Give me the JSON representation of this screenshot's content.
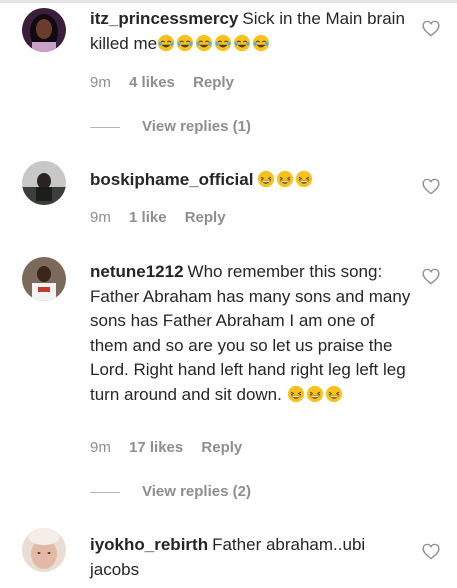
{
  "comments": [
    {
      "username": "itz_princessmercy",
      "text": "Sick in the Main brain killed me",
      "emoji": [
        "face-with-tears-of-joy-icon",
        "face-with-tears-of-joy-icon",
        "face-with-tears-of-joy-icon",
        "face-with-tears-of-joy-icon",
        "face-with-tears-of-joy-icon",
        "face-with-tears-of-joy-icon"
      ],
      "time": "9m",
      "likes": "4 likes",
      "reply": "Reply",
      "view_replies": "View replies (1)"
    },
    {
      "username": "boskiphame_official",
      "text": "",
      "emoji": [
        "laughing-face-icon",
        "laughing-face-icon",
        "laughing-face-icon"
      ],
      "time": "9m",
      "likes": "1 like",
      "reply": "Reply"
    },
    {
      "username": "netune1212",
      "text": "Who remember this song: Father Abraham has many sons and many sons has Father Abraham I am one of them and so are you so let us praise the Lord. Right hand left hand right leg left leg turn around and sit down.",
      "emoji": [
        "laughing-face-icon",
        "laughing-face-icon",
        "laughing-face-icon"
      ],
      "time": "9m",
      "likes": "17 likes",
      "reply": "Reply",
      "view_replies": "View replies (2)"
    },
    {
      "username": "iyokho_rebirth",
      "text": "Father abraham..ubi jacobs"
    }
  ],
  "icons": {
    "like": "heart-outline-icon"
  },
  "colors": {
    "text": "#262626",
    "muted": "#8e8e8e",
    "emoji_yellow": "#f7c21b"
  }
}
